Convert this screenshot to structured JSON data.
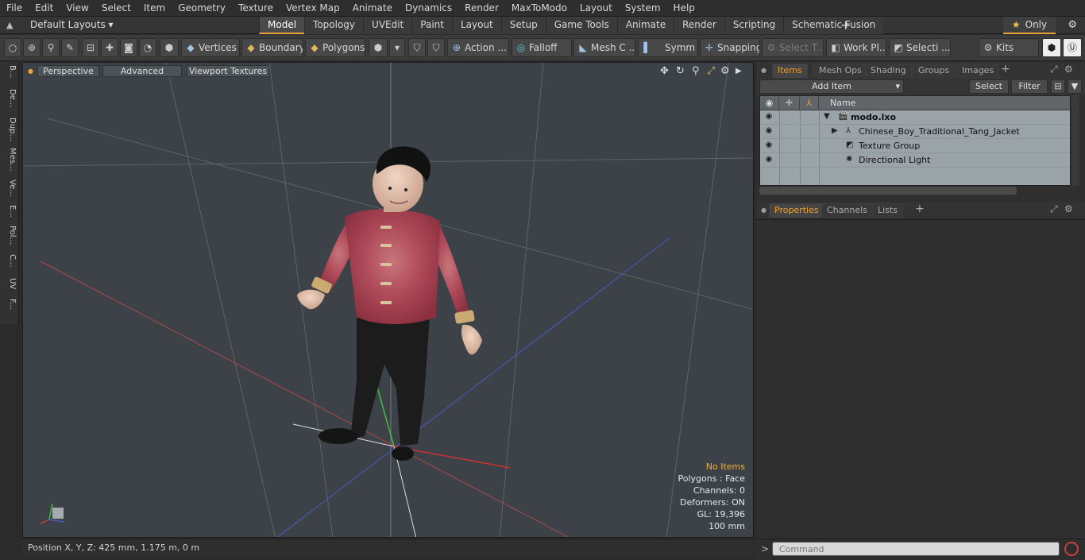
{
  "menubar": {
    "items": [
      "File",
      "Edit",
      "View",
      "Select",
      "Item",
      "Geometry",
      "Texture",
      "Vertex Map",
      "Animate",
      "Dynamics",
      "Render",
      "MaxToModo",
      "Layout",
      "System",
      "Help"
    ]
  },
  "layoutbar": {
    "layouts_label": "Default Layouts ▾",
    "tabs": [
      "Model",
      "Topology",
      "UVEdit",
      "Paint",
      "Layout",
      "Setup",
      "Game Tools",
      "Animate",
      "Render",
      "Scripting",
      "Schematic Fusion"
    ],
    "active_tab": "Model",
    "only_label": "Only"
  },
  "toolbar": {
    "vertices": "Vertices",
    "boundary": "Boundary",
    "polygons": "Polygons",
    "action": "Action",
    "falloff": "Falloff",
    "mesh": "Mesh C ...",
    "symmetry": "Symm ...",
    "snapping": "Snapping",
    "select_t": "Select T...",
    "work_plane": "Work Pl...",
    "selection": "Selecti ...",
    "kits": "Kits"
  },
  "lefttabs": [
    "B...",
    "De...",
    "Dup...",
    "Mes...",
    "Ve...",
    "E...",
    "Pol...",
    "C...",
    "UV",
    "F..."
  ],
  "viewport": {
    "perspective": "Perspective",
    "advanced": "Advanced",
    "viewport_textures": "Viewport Textures",
    "info": {
      "items": "No Items",
      "polygons": "Polygons : Face",
      "channels": "Channels: 0",
      "deformers": "Deformers: ON",
      "gl": "GL: 19,396",
      "scale": "100 mm"
    }
  },
  "statusbar": {
    "position": "Position X, Y, Z:   425 mm, 1.175 m, 0 m"
  },
  "items_panel": {
    "tabs": [
      "Items",
      "Mesh Ops",
      "Shading",
      "Groups",
      "Images"
    ],
    "active_tab": "Items",
    "add_item": "Add Item",
    "select": "Select",
    "filter": "Filter",
    "column_name": "Name",
    "tree": [
      {
        "label": "modo.lxo",
        "bold": true
      },
      {
        "label": "Chinese_Boy_Traditional_Tang_Jacket",
        "bold": false
      },
      {
        "label": "Texture Group",
        "bold": false
      },
      {
        "label": "Directional Light",
        "bold": false
      }
    ]
  },
  "properties_panel": {
    "tabs": [
      "Properties",
      "Channels",
      "Lists"
    ],
    "active_tab": "Properties"
  },
  "command": {
    "prompt": ">",
    "placeholder": "Command"
  }
}
